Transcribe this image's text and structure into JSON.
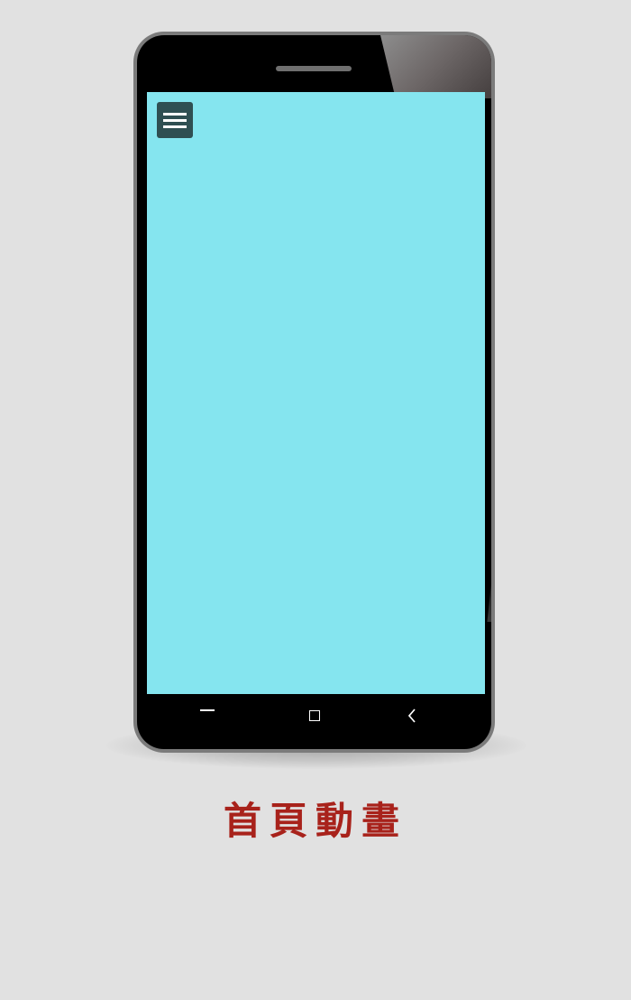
{
  "caption": "首頁動畫",
  "colors": {
    "background": "#e1e1e1",
    "phone_body": "#000000",
    "phone_rim": "#7b7b7b",
    "screen": "#85e5ef",
    "menu_button": "#2f4f52",
    "caption": "#a8221b"
  },
  "icons": {
    "menu": "hamburger-menu-icon",
    "nav_recents": "minus-icon",
    "nav_home": "square-icon",
    "nav_back": "chevron-left-icon"
  }
}
